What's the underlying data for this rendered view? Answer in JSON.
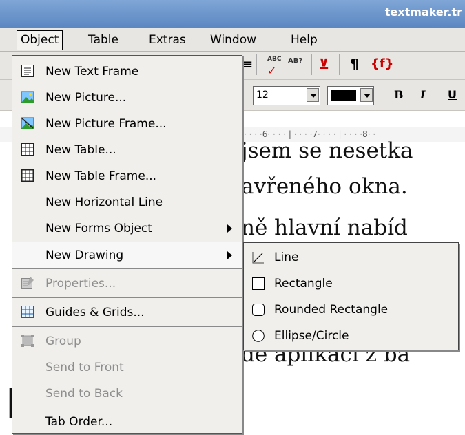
{
  "window": {
    "title": "textmaker.tr"
  },
  "menubar": {
    "items": [
      {
        "label": "Object"
      },
      {
        "label": "Table"
      },
      {
        "label": "Extras"
      },
      {
        "label": "Window"
      },
      {
        "label": "Help"
      }
    ]
  },
  "toolbar": {
    "font_size": "12",
    "bold_label": "B",
    "italic_label": "I",
    "underline_label": "U",
    "pilcrow_label": "¶",
    "field_label": "{f}",
    "spell_label": "ABC",
    "thesaurus_label": "AB?"
  },
  "ruler": {
    "marks": "· · · ·6· · · · | · · · ·7· · · · | · · · ·8· ·"
  },
  "document": {
    "lines": [
      "jsem se nesetka",
      "avřeného okna.",
      "ně hlavní nabíd",
      "",
      "",
      "",
      "dě aplikací z ba"
    ]
  },
  "object_menu": {
    "items": [
      {
        "label": "New Text Frame",
        "icon": "text-frame-icon",
        "enabled": true
      },
      {
        "label": "New Picture...",
        "icon": "picture-icon",
        "enabled": true
      },
      {
        "label": "New Picture Frame...",
        "icon": "picture-frame-icon",
        "enabled": true
      },
      {
        "label": "New Table...",
        "icon": "table-icon",
        "enabled": true
      },
      {
        "label": "New Table Frame...",
        "icon": "table-frame-icon",
        "enabled": true
      },
      {
        "label": "New Horizontal Line",
        "enabled": true
      },
      {
        "label": "New Forms Object",
        "enabled": true,
        "submenu": true
      },
      {
        "label": "New Drawing",
        "enabled": true,
        "submenu": true,
        "highlighted": true
      },
      {
        "label": "Properties...",
        "icon": "properties-icon",
        "enabled": false
      },
      {
        "label": "Guides & Grids...",
        "icon": "grid-icon",
        "enabled": true
      },
      {
        "label": "Group",
        "icon": "group-icon",
        "enabled": false
      },
      {
        "label": "Send to Front",
        "enabled": false
      },
      {
        "label": "Send to Back",
        "enabled": false
      },
      {
        "label": "Tab Order...",
        "enabled": true
      }
    ]
  },
  "drawing_submenu": {
    "items": [
      {
        "label": "Line",
        "icon": "line-icon"
      },
      {
        "label": "Rectangle",
        "icon": "rectangle-icon"
      },
      {
        "label": "Rounded Rectangle",
        "icon": "rounded-rectangle-icon"
      },
      {
        "label": "Ellipse/Circle",
        "icon": "ellipse-icon"
      }
    ]
  }
}
